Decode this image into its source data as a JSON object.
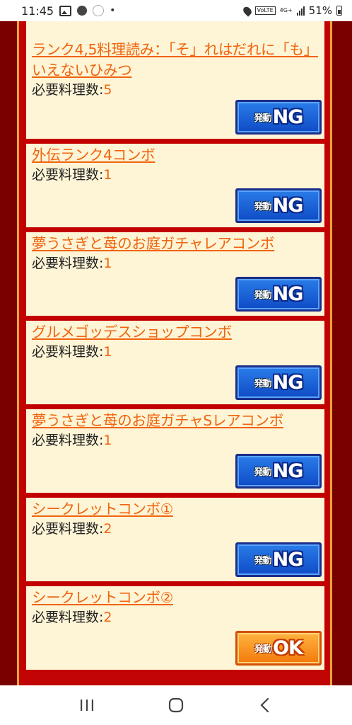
{
  "status": {
    "time": "11:45",
    "volte": "VoLTE",
    "network": "4G+",
    "battery": "51%"
  },
  "items": [
    {
      "title": "ランク4,5料理読み：「そ」れはだれに「も」いえないひみつ",
      "req_label": "必要料理数:",
      "req_value": "5",
      "button": "NG",
      "prefix": "発動"
    },
    {
      "title": "外伝ランク4コンボ",
      "req_label": "必要料理数:",
      "req_value": "1",
      "button": "NG",
      "prefix": "発動"
    },
    {
      "title": "夢うさぎと苺のお庭ガチャレアコンボ",
      "req_label": "必要料理数:",
      "req_value": "1",
      "button": "NG",
      "prefix": "発動"
    },
    {
      "title": "グルメゴッデスショップコンボ",
      "req_label": "必要料理数:",
      "req_value": "1",
      "button": "NG",
      "prefix": "発動"
    },
    {
      "title": "夢うさぎと苺のお庭ガチャSレアコンボ",
      "req_label": "必要料理数:",
      "req_value": "1",
      "button": "NG",
      "prefix": "発動"
    },
    {
      "title": "シークレットコンボ①",
      "req_label": "必要料理数:",
      "req_value": "2",
      "button": "NG",
      "prefix": "発動"
    },
    {
      "title": "シークレットコンボ②",
      "req_label": "必要料理数:",
      "req_value": "2",
      "button": "OK",
      "prefix": "発動"
    }
  ],
  "colors": {
    "title": "#f0640e",
    "card_bg": "#fef4d6",
    "border": "#c30000",
    "ng": "#1f63d8",
    "ok": "#f7921e"
  }
}
